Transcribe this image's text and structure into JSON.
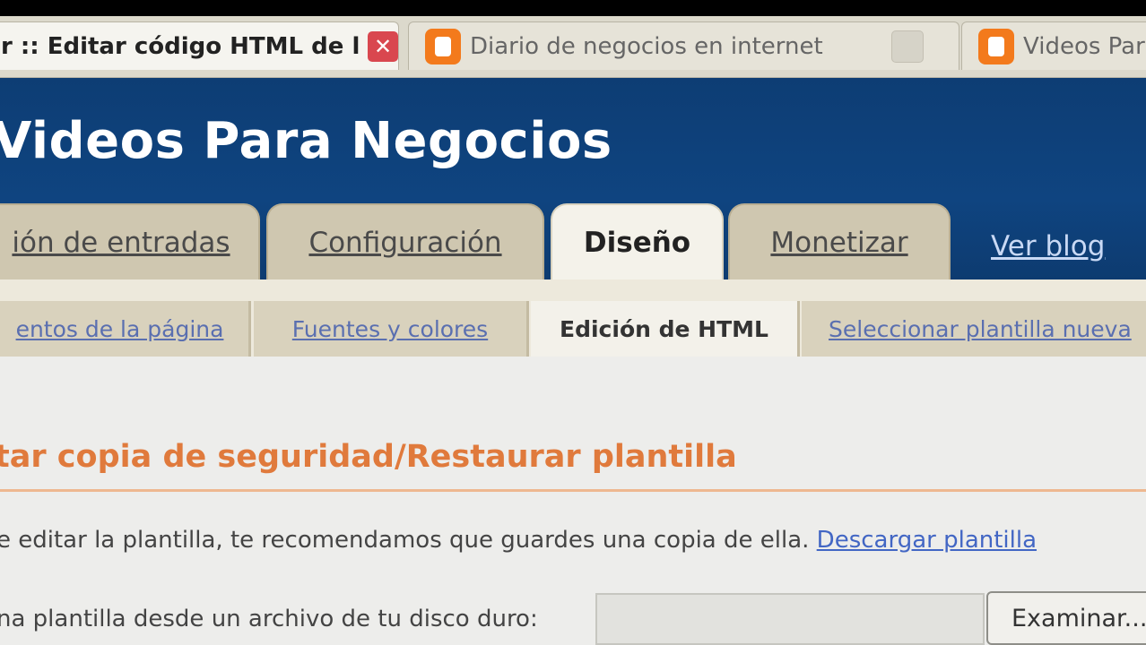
{
  "browser": {
    "tabs": [
      {
        "label": "r :: Editar código HTML de l...",
        "active": true
      },
      {
        "label": "Diario de negocios en internet",
        "active": false
      },
      {
        "label": "Videos Para",
        "active": false
      }
    ]
  },
  "header": {
    "blog_title": "Videos Para Negocios",
    "main_tabs": [
      {
        "label": "ión de entradas"
      },
      {
        "label": "Configuración"
      },
      {
        "label": "Diseño"
      },
      {
        "label": "Monetizar"
      }
    ],
    "view_blog": "Ver blog"
  },
  "subtabs": [
    {
      "label": "entos de la página"
    },
    {
      "label": "Fuentes y colores"
    },
    {
      "label": "Edición de HTML"
    },
    {
      "label": "Seleccionar plantilla nueva"
    }
  ],
  "content": {
    "section_title": "tar copia de seguridad/Restaurar plantilla",
    "backup_text": "e editar la plantilla, te recomendamos que guardes una copia de ella.",
    "download_link": "Descargar plantilla",
    "upload_text": "na plantilla desde un archivo de tu disco duro:",
    "browse_button": "Examinar..."
  },
  "colors": {
    "header_bg": "#0f4480",
    "accent_orange": "#e07a3c",
    "link_blue": "#4266c4",
    "blogger_orange": "#f37a1c"
  }
}
